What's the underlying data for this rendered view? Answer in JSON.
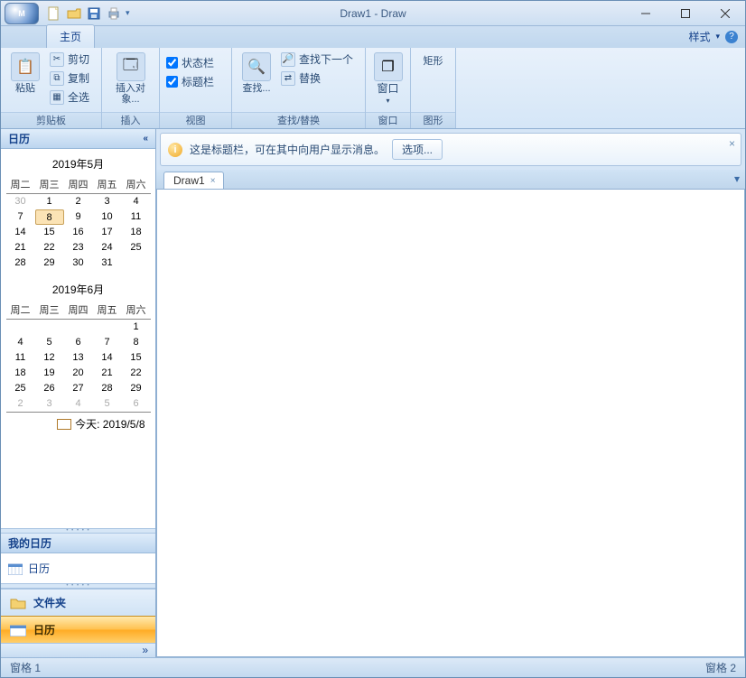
{
  "app": {
    "title": "Draw1 - Draw"
  },
  "qat": {
    "dropdown": "▾"
  },
  "ribbon": {
    "tab_home": "主页",
    "style_label": "样式",
    "groups": {
      "clipboard": {
        "label": "剪贴板",
        "paste": "粘贴",
        "cut": "剪切",
        "copy": "复制",
        "selectall": "全选"
      },
      "insert": {
        "label": "插入",
        "insertobj": "插入对象..."
      },
      "view": {
        "label": "视图",
        "statusbar": "状态栏",
        "titlebar": "标题栏"
      },
      "findreplace": {
        "label": "查找/替换",
        "find": "查找...",
        "findnext": "查找下一个",
        "replace": "替换"
      },
      "window": {
        "label": "窗口",
        "window_btn": "窗口"
      },
      "shapes": {
        "label": "图形",
        "rect": "矩形"
      }
    }
  },
  "sidebar": {
    "calendar_title": "日历",
    "cal1": {
      "title": "2019年5月",
      "dow": [
        "周二",
        "周三",
        "周四",
        "周五",
        "周六"
      ],
      "rows": [
        [
          {
            "d": "30",
            "dim": true
          },
          {
            "d": "1"
          },
          {
            "d": "2"
          },
          {
            "d": "3"
          },
          {
            "d": "4"
          }
        ],
        [
          {
            "d": "7"
          },
          {
            "d": "8",
            "sel": true
          },
          {
            "d": "9"
          },
          {
            "d": "10"
          },
          {
            "d": "11"
          }
        ],
        [
          {
            "d": "14"
          },
          {
            "d": "15"
          },
          {
            "d": "16"
          },
          {
            "d": "17"
          },
          {
            "d": "18"
          }
        ],
        [
          {
            "d": "21"
          },
          {
            "d": "22"
          },
          {
            "d": "23"
          },
          {
            "d": "24"
          },
          {
            "d": "25"
          }
        ],
        [
          {
            "d": "28"
          },
          {
            "d": "29"
          },
          {
            "d": "30"
          },
          {
            "d": "31"
          },
          {
            "d": ""
          }
        ]
      ]
    },
    "cal2": {
      "title": "2019年6月",
      "dow": [
        "周二",
        "周三",
        "周四",
        "周五",
        "周六"
      ],
      "rows": [
        [
          {
            "d": ""
          },
          {
            "d": ""
          },
          {
            "d": ""
          },
          {
            "d": ""
          },
          {
            "d": "1"
          }
        ],
        [
          {
            "d": "4"
          },
          {
            "d": "5"
          },
          {
            "d": "6"
          },
          {
            "d": "7"
          },
          {
            "d": "8"
          }
        ],
        [
          {
            "d": "11"
          },
          {
            "d": "12"
          },
          {
            "d": "13"
          },
          {
            "d": "14"
          },
          {
            "d": "15"
          }
        ],
        [
          {
            "d": "18"
          },
          {
            "d": "19"
          },
          {
            "d": "20"
          },
          {
            "d": "21"
          },
          {
            "d": "22"
          }
        ],
        [
          {
            "d": "25"
          },
          {
            "d": "26"
          },
          {
            "d": "27"
          },
          {
            "d": "28"
          },
          {
            "d": "29"
          }
        ],
        [
          {
            "d": "2",
            "dim": true
          },
          {
            "d": "3",
            "dim": true
          },
          {
            "d": "4",
            "dim": true
          },
          {
            "d": "5",
            "dim": true
          },
          {
            "d": "6",
            "dim": true
          }
        ]
      ]
    },
    "today_label": "今天: 2019/5/8",
    "mycal_header": "我的日历",
    "mycal_item": "日历",
    "nav_folder": "文件夹",
    "nav_calendar": "日历",
    "expand_glyph": "»"
  },
  "caption": {
    "text": "这是标题栏，可在其中向用户显示消息。",
    "options": "选项..."
  },
  "doc": {
    "tab1": "Draw1"
  },
  "status": {
    "left": "窗格 1",
    "right": "窗格 2"
  }
}
